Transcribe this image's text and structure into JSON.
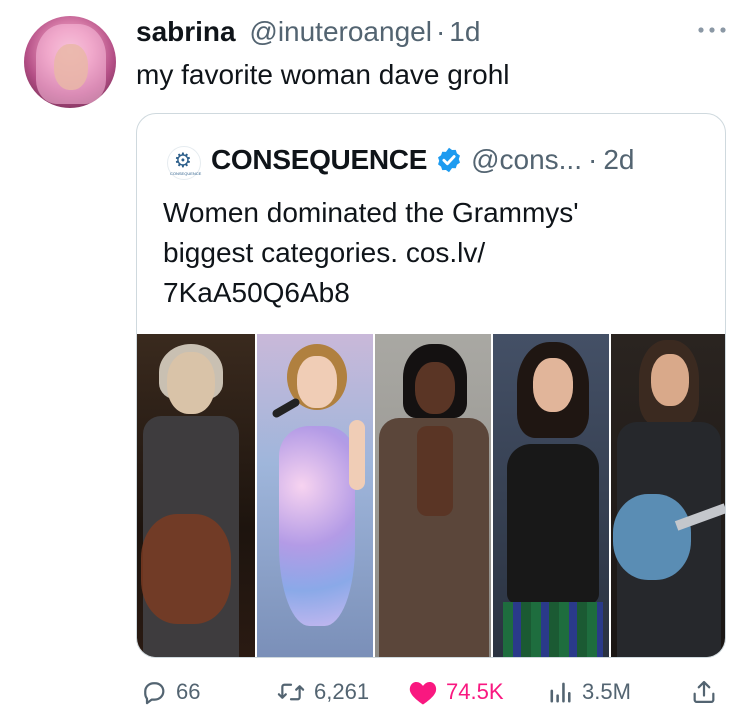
{
  "author": {
    "name": "sabrina",
    "handle": "@inuteroangel",
    "separator": "·",
    "time": "1d"
  },
  "tweet": {
    "text": "my favorite woman dave grohl"
  },
  "quoted": {
    "name": "CONSEQUENCE",
    "handle": "@cons...",
    "separator": "·",
    "time": "2d",
    "avatar_caption": "CONSEQUENCE",
    "text_line1": "Women dominated the Grammys'",
    "text_line2": "biggest categories. cos.lv/",
    "text_line3": "7KaA50Q6Ab8",
    "verified_color": "#1d9bf0"
  },
  "actions": {
    "replies": "66",
    "reposts": "6,261",
    "likes": "74.5K",
    "views": "3.5M"
  },
  "colors": {
    "secondary_text": "#536471",
    "like_pink": "#f91880",
    "border": "#cfd9de"
  }
}
